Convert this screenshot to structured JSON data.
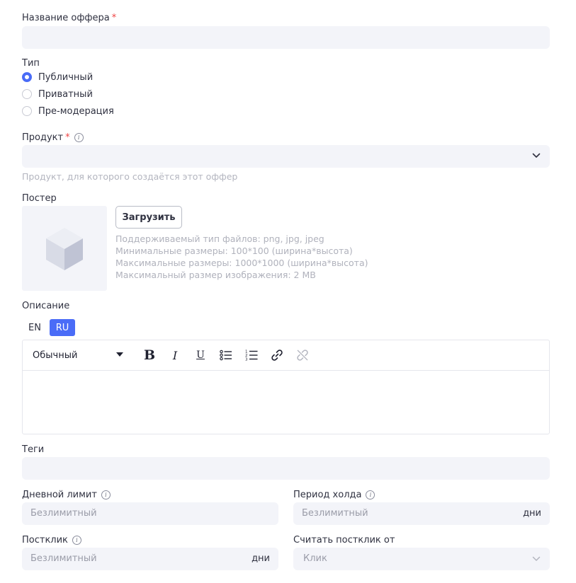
{
  "offer_name": {
    "label": "Название оффера",
    "required_mark": "*",
    "value": ""
  },
  "type": {
    "label": "Тип",
    "options": [
      {
        "label": "Публичный",
        "selected": true
      },
      {
        "label": "Приватный",
        "selected": false
      },
      {
        "label": "Пре-модерация",
        "selected": false
      }
    ]
  },
  "product": {
    "label": "Продукт",
    "required_mark": "*",
    "value": "",
    "hint": "Продукт, для которого создаётся этот оффер"
  },
  "poster": {
    "label": "Постер",
    "upload_label": "Загрузить",
    "hints": [
      "Поддерживаемый тип файлов: png, jpg, jpeg",
      "Минимальные размеры: 100*100 (ширина*высота)",
      "Максимальные размеры: 1000*1000 (ширина*высота)",
      "Максимальный размер изображения: 2 MB"
    ]
  },
  "description": {
    "label": "Описание",
    "langs": [
      {
        "label": "EN",
        "active": false
      },
      {
        "label": "RU",
        "active": true
      }
    ],
    "toolbar": {
      "format_value": "Обычный"
    },
    "content": ""
  },
  "tags": {
    "label": "Теги",
    "value": ""
  },
  "daily_limit": {
    "label": "Дневной лимит",
    "placeholder": "Безлимитный"
  },
  "hold_period": {
    "label": "Период холда",
    "placeholder": "Безлимитный",
    "suffix": "дни"
  },
  "postclick": {
    "label": "Постклик",
    "placeholder": "Безлимитный",
    "suffix": "дни"
  },
  "postclick_from": {
    "label": "Считать постклик от",
    "value": "Клик"
  },
  "colors": {
    "accent": "#4a6cf7",
    "input_bg": "#f3f4f9",
    "required": "#ef4444"
  }
}
